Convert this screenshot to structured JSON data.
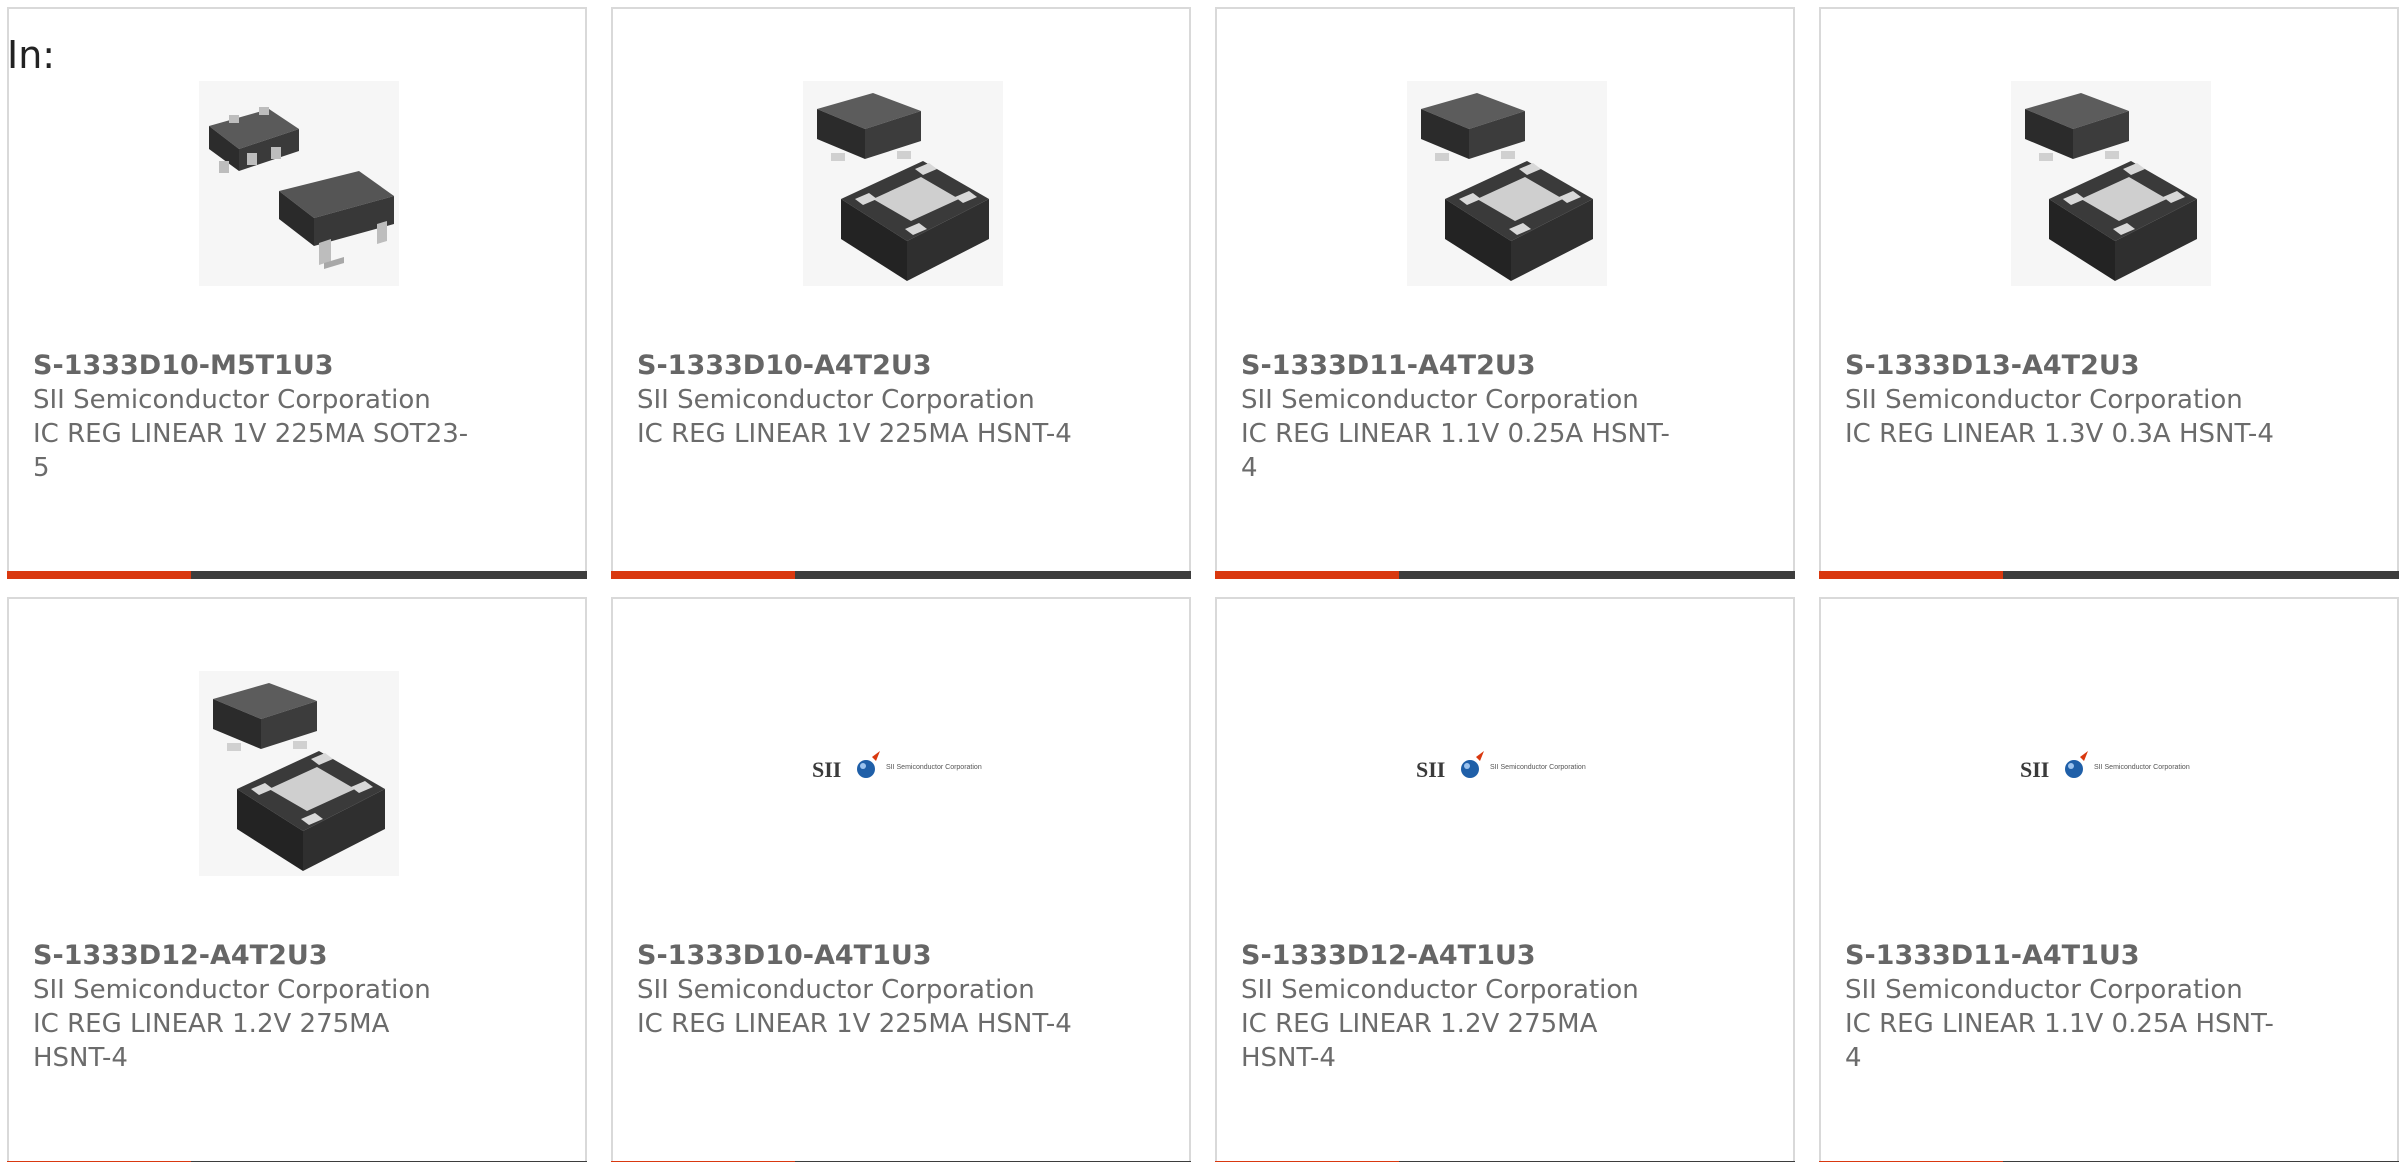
{
  "header": {
    "label": "In:"
  },
  "colors": {
    "accent": "#d9380f",
    "bar": "#3d3d3d",
    "border": "#d9d9d9",
    "text": "#6b6b6b"
  },
  "products": [
    {
      "part": "S-1333D10-M5T1U3",
      "manufacturer": "SII Semiconductor Corporation",
      "description": "IC REG LINEAR 1V 225MA SOT23-5",
      "image": "sot23-5-package"
    },
    {
      "part": "S-1333D10-A4T2U3",
      "manufacturer": "SII Semiconductor Corporation",
      "description": "IC REG LINEAR 1V 225MA HSNT-4",
      "image": "hsnt-4-package"
    },
    {
      "part": "S-1333D11-A4T2U3",
      "manufacturer": "SII Semiconductor Corporation",
      "description": "IC REG LINEAR 1.1V 0.25A HSNT-4",
      "image": "hsnt-4-package"
    },
    {
      "part": "S-1333D13-A4T2U3",
      "manufacturer": "SII Semiconductor Corporation",
      "description": "IC REG LINEAR 1.3V 0.3A HSNT-4",
      "image": "hsnt-4-package"
    },
    {
      "part": "S-1333D12-A4T2U3",
      "manufacturer": "SII Semiconductor Corporation",
      "description": "IC REG LINEAR 1.2V 275MA HSNT-4",
      "image": "hsnt-4-package"
    },
    {
      "part": "S-1333D10-A4T1U3",
      "manufacturer": "SII Semiconductor Corporation",
      "description": "IC REG LINEAR 1V 225MA HSNT-4",
      "image": "sii-logo"
    },
    {
      "part": "S-1333D12-A4T1U3",
      "manufacturer": "SII Semiconductor Corporation",
      "description": "IC REG LINEAR 1.2V 275MA HSNT-4",
      "image": "sii-logo"
    },
    {
      "part": "S-1333D11-A4T1U3",
      "manufacturer": "SII Semiconductor Corporation",
      "description": "IC REG LINEAR 1.1V 0.25A HSNT-4",
      "image": "sii-logo"
    }
  ],
  "logo": {
    "text": "SII",
    "tagline": "SII Semiconductor Corporation"
  }
}
